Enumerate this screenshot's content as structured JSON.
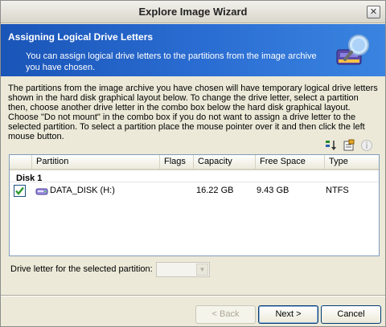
{
  "window": {
    "title": "Explore Image Wizard",
    "close_label": "✕"
  },
  "banner": {
    "title": "Assigning Logical Drive Letters",
    "description": "You can assign logical drive letters to the partitions from the image archive you have chosen."
  },
  "intro": {
    "text": "The partitions from the image archive you have chosen will have temporary logical drive letters shown in the hard disk graphical layout below. To change the drive letter, select a partition then, choose another drive letter in the combo box below the hard disk graphical layout. Choose \"Do not mount\" in the combo box if you do not want to assign a drive letter to the selected partition. To select a partition place the mouse pointer over it and then click the left mouse button."
  },
  "toolbar": {
    "icons": [
      "sort-icon",
      "properties-icon",
      "info-icon"
    ]
  },
  "table": {
    "columns": [
      "",
      "Partition",
      "Flags",
      "Capacity",
      "Free Space",
      "Type"
    ],
    "disk_label": "Disk 1",
    "rows": [
      {
        "checked": true,
        "partition": "DATA_DISK (H:)",
        "flags": "",
        "capacity": "16.22 GB",
        "free_space": "9.43 GB",
        "type": "NTFS"
      }
    ]
  },
  "drive_letter": {
    "label": "Drive letter for the selected partition:",
    "value": ""
  },
  "buttons": {
    "back": "< Back",
    "next": "Next >",
    "cancel": "Cancel"
  },
  "colors": {
    "banner": "#2b6ed3",
    "check": "#2f9a2f"
  }
}
